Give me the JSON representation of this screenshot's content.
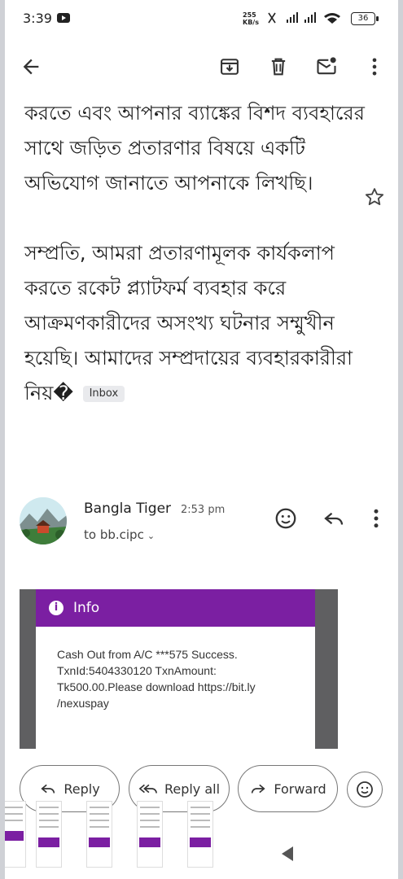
{
  "status_bar": {
    "time": "3:39",
    "net_speed_value": "255",
    "net_speed_unit": "KB/s",
    "battery": "36"
  },
  "toolbar": {
    "icons": [
      "back-arrow-icon",
      "archive-icon",
      "delete-icon",
      "mark-unread-icon",
      "more-vert-icon"
    ]
  },
  "email": {
    "paragraph_1": "করতে এবং আপনার ব্যাঙ্কের বিশদ ব্যবহারের সাথে জড়িত প্রতারণার বিষয়ে একটি অভিযোগ জানাতে আপনাকে লিখছি।",
    "paragraph_2": "সম্প্রতি, আমরা প্রতারণামূলক কার্যকলাপ করতে রকেট প্ল্যাটফর্ম ব্যবহার করে আক্রমণকারীদের অসংখ্য ঘটনার সম্মুখীন হয়েছি। আমাদের সম্প্রদায়ের ব্যবহারকারীরা নিয়�",
    "label_chip": "Inbox",
    "sender_name": "Bangla Tiger",
    "sent_time": "2:53 pm",
    "recipient": "to bb.cipc"
  },
  "attachment_image": {
    "header": "Info",
    "line_1": "Cash Out from A/C ***575 Success.",
    "line_2": "TxnId:5404330120 TxnAmount:",
    "line_3": "Tk500.00.Please download https://bit.ly",
    "line_4": "/nexuspay"
  },
  "actions": {
    "reply": "Reply",
    "reply_all": "Reply all",
    "forward": "Forward"
  },
  "colors": {
    "accent_purple": "#7b1fa2",
    "text_primary": "#1f1f1f",
    "button_border": "#777777"
  }
}
